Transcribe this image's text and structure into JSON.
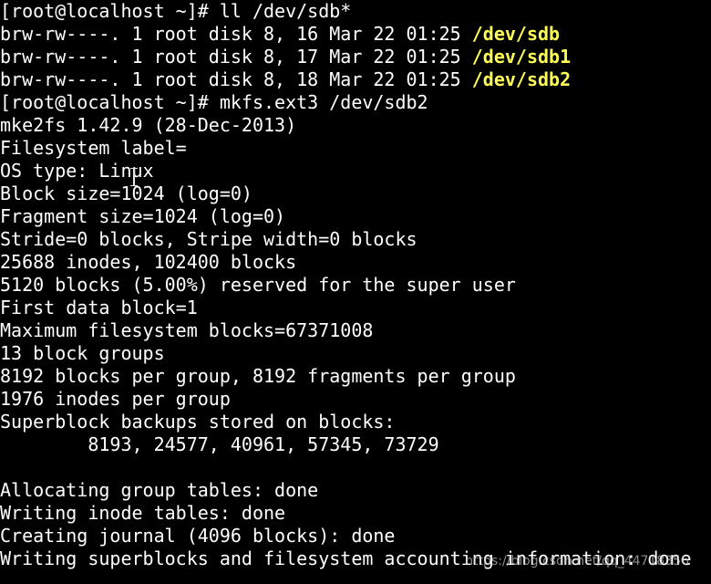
{
  "colors": {
    "background": "#000000",
    "text": "#ffffff",
    "highlight": "#ffff55"
  },
  "lines": [
    {
      "text": "[root@localhost ~]# ll /dev/sdb*"
    },
    {
      "text": "brw-rw----. 1 root disk 8, 16 Mar 22 01:25 ",
      "hl": "/dev/sdb"
    },
    {
      "text": "brw-rw----. 1 root disk 8, 17 Mar 22 01:25 ",
      "hl": "/dev/sdb1"
    },
    {
      "text": "brw-rw----. 1 root disk 8, 18 Mar 22 01:25 ",
      "hl": "/dev/sdb2"
    },
    {
      "text": "[root@localhost ~]# mkfs.ext3 /dev/sdb2"
    },
    {
      "text": "mke2fs 1.42.9 (28-Dec-2013)"
    },
    {
      "text": "Filesystem label="
    },
    {
      "text": "OS type: Linux"
    },
    {
      "text": "Block size=1024 (log=0)"
    },
    {
      "text": "Fragment size=1024 (log=0)"
    },
    {
      "text": "Stride=0 blocks, Stripe width=0 blocks"
    },
    {
      "text": "25688 inodes, 102400 blocks"
    },
    {
      "text": "5120 blocks (5.00%) reserved for the super user"
    },
    {
      "text": "First data block=1"
    },
    {
      "text": "Maximum filesystem blocks=67371008"
    },
    {
      "text": "13 block groups"
    },
    {
      "text": "8192 blocks per group, 8192 fragments per group"
    },
    {
      "text": "1976 inodes per group"
    },
    {
      "text": "Superblock backups stored on blocks:"
    },
    {
      "text": "        8193, 24577, 40961, 57345, 73729"
    },
    {
      "text": ""
    },
    {
      "text": "Allocating group tables: done"
    },
    {
      "text": "Writing inode tables: done"
    },
    {
      "text": "Creating journal (4096 blocks): done"
    },
    {
      "text": "Writing superblocks and filesystem accounting information: done"
    }
  ],
  "watermark": "https://blog.csdn.net/qq_44718356"
}
